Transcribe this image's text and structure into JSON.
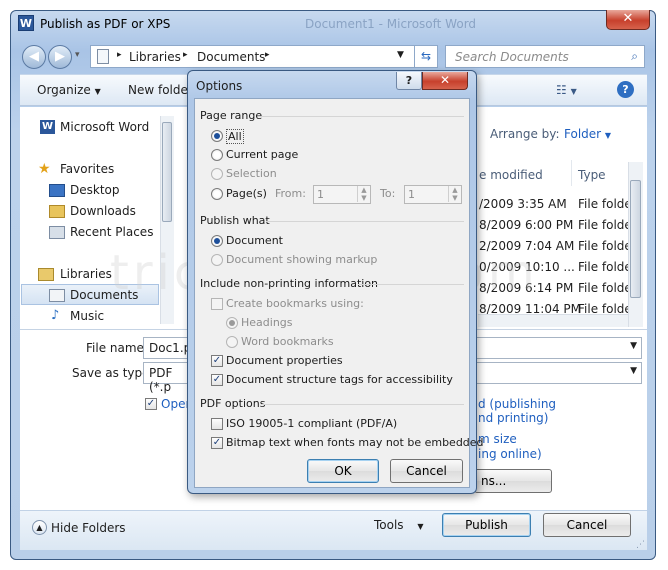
{
  "window": {
    "title": "Publish as PDF or XPS",
    "title_ghost": "Document1 - Microsoft Word",
    "close_glyph": "✕",
    "app_glyph": "W"
  },
  "address": {
    "crumbs": [
      "Libraries",
      "Documents"
    ],
    "search_placeholder": "Search Documents"
  },
  "toolbar": {
    "organize": "Organize",
    "new_folder": "New folder"
  },
  "nav": {
    "items": [
      {
        "label": "Microsoft Word"
      },
      {
        "label": "Favorites"
      },
      {
        "label": "Desktop"
      },
      {
        "label": "Downloads"
      },
      {
        "label": "Recent Places"
      },
      {
        "label": "Libraries"
      },
      {
        "label": "Documents"
      },
      {
        "label": "Music"
      }
    ]
  },
  "library": {
    "arrange_by_label": "Arrange by:",
    "arrange_value": "Folder",
    "columns": [
      "e modified",
      "Type"
    ],
    "rows": [
      {
        "date": "/2009 3:35 AM",
        "type": "File folder"
      },
      {
        "date": "8/2009 6:00 PM",
        "type": "File folder"
      },
      {
        "date": "2/2009 7:04 AM",
        "type": "File folder"
      },
      {
        "date": "0/2009 10:10 ...",
        "type": "File folder"
      },
      {
        "date": "8/2009 6:14 PM",
        "type": "File folder"
      },
      {
        "date": "8/2009 11:04 PM",
        "type": "File folder"
      }
    ]
  },
  "form": {
    "filename_label": "File name:",
    "filename_value": "Doc1.p",
    "savetype_label": "Save as type:",
    "savetype_value": "PDF (*.p",
    "open_label": "Open",
    "opt1_line1": "d (publishing",
    "opt1_line2": "nd printing)",
    "opt2_line1": "m size",
    "opt2_line2": "ing online)",
    "options_btn": "ns..."
  },
  "bottom": {
    "hide_folders": "Hide Folders",
    "tools": "Tools",
    "publish": "Publish",
    "cancel": "Cancel"
  },
  "watermark": "trickyways.com",
  "options": {
    "title": "Options",
    "help": "?",
    "close": "✕",
    "page_range": {
      "heading": "Page range",
      "all": "All",
      "current_page": "Current page",
      "selection": "Selection",
      "pages": "Page(s)",
      "from_label": "From:",
      "from_value": "1",
      "to_label": "To:",
      "to_value": "1"
    },
    "publish_what": {
      "heading": "Publish what",
      "document": "Document",
      "document_markup": "Document showing markup"
    },
    "non_printing": {
      "heading": "Include non-printing information",
      "create_bookmarks": "Create bookmarks using:",
      "headings": "Headings",
      "word_bookmarks": "Word bookmarks",
      "doc_properties": "Document properties",
      "doc_structure": "Document structure tags for accessibility"
    },
    "pdf_options": {
      "heading": "PDF options",
      "iso": "ISO 19005-1 compliant (PDF/A)",
      "bitmap": "Bitmap text when fonts may not be embedded"
    },
    "ok": "OK",
    "cancel": "Cancel"
  }
}
